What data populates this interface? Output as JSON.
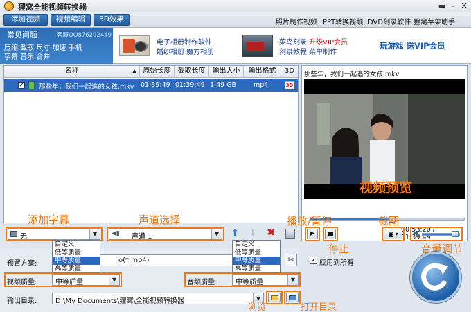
{
  "app": {
    "title": "狸窝全能视频转换器"
  },
  "menu": {
    "add_video": "添加视频",
    "edit_video": "视频编辑",
    "effect_3d": "3D效果"
  },
  "top_links": [
    "照片制作视频",
    "PPT转换视频",
    "DVD刻录软件",
    "狸窝苹果助手"
  ],
  "faq": {
    "title": "常见问题",
    "support": "客服QQ876292449",
    "line1": "压缩 截取 尺寸 加速 手机",
    "line2": "字幕 音乐 合并"
  },
  "banner": {
    "ad1_line1": "电子相册制作软件",
    "ad1_line2": "婚纱相册 魔方相册",
    "ad2_line1a": "菜鸟刻录",
    "ad2_line1b": "升级VIP会员",
    "ad2_line2": "刻录教程 菜单制作",
    "ad3": "玩游戏 送VIP会员"
  },
  "table": {
    "headers": [
      "名称",
      "原始长度",
      "截取长度",
      "输出大小",
      "输出格式",
      "3D"
    ],
    "rows": [
      {
        "name": "那些年，我们一起追的女孩.mkv",
        "orig": "01:39:49",
        "cut": "01:39:49",
        "size": "1.49 GB",
        "format": "mp4"
      }
    ]
  },
  "preview": {
    "filename": "那些年，我们一起追的女孩.mkv",
    "overlay": "视频预览",
    "time": "00:53:20 / 01:39:49"
  },
  "annotations": {
    "subtitle": "添加字幕",
    "audio_track": "声道选择",
    "play_pause": "播放/暂停",
    "stop": "停止",
    "screenshot": "截图",
    "volume": "音量调节",
    "browse": "浏览",
    "open_dir": "打开目录"
  },
  "subtitle_combo": "无",
  "audio_combo": "声道 1",
  "quality_options": [
    "自定义",
    "低等质量",
    "中等质量",
    "高等质量"
  ],
  "preset": {
    "label": "预置方案:",
    "value": "o(*.mp4)"
  },
  "apply_all": "应用到所有",
  "video_quality": {
    "label": "视频质量:",
    "value": "中等质量"
  },
  "audio_quality": {
    "label": "音频质量:",
    "value": "中等质量"
  },
  "output": {
    "label": "输出目录:",
    "path": "D:\\My Documents\\狸窝\\全能视频转换器"
  },
  "progress": {
    "seek_fraction": 0.53,
    "volume_fraction": 0.8
  },
  "colors": {
    "accent": "#2c6ac0",
    "annotation": "#f07a12"
  }
}
